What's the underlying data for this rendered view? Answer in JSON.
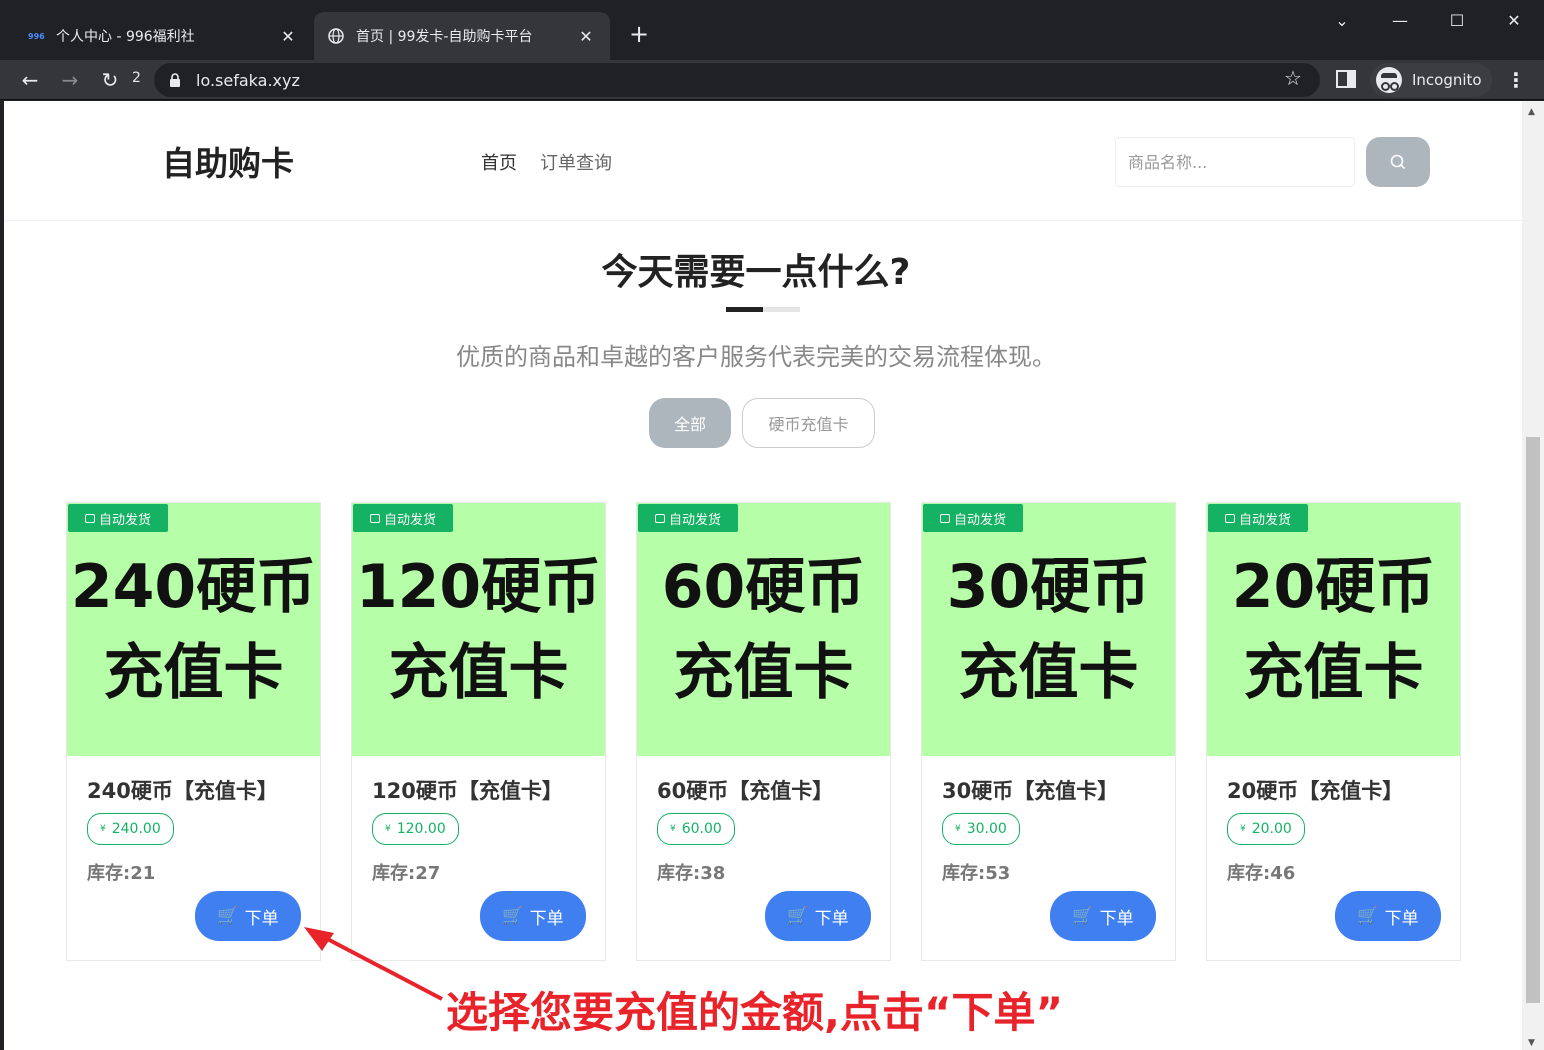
{
  "browser": {
    "tabs": [
      {
        "favicon": "996",
        "title": "个人中心 - 996福利社",
        "active": false
      },
      {
        "favicon": "globe-icon",
        "title": "首页 | 99发卡-自助购卡平台",
        "active": true
      }
    ],
    "reload_count": "2",
    "url": "lo.sefaka.xyz",
    "profile_label": "Incognito"
  },
  "site": {
    "brand": "自助购卡",
    "nav": [
      "首页",
      "订单查询"
    ],
    "search_placeholder": "商品名称..."
  },
  "hero": {
    "title": "今天需要一点什么?",
    "subtitle": "优质的商品和卓越的客户服务代表完美的交易流程体现。"
  },
  "filters": [
    "全部",
    "硬币充值卡"
  ],
  "badge_text": "自动发货",
  "order_label": "下单",
  "stock_prefix": "库存:",
  "products": [
    {
      "img_line1": "240硬币",
      "img_line2": "充值卡",
      "title": "240硬币【充值卡】",
      "price": "240.00",
      "stock": "21"
    },
    {
      "img_line1": "120硬币",
      "img_line2": "充值卡",
      "title": "120硬币【充值卡】",
      "price": "120.00",
      "stock": "27"
    },
    {
      "img_line1": "60硬币",
      "img_line2": "充值卡",
      "title": "60硬币【充值卡】",
      "price": "60.00",
      "stock": "38"
    },
    {
      "img_line1": "30硬币",
      "img_line2": "充值卡",
      "title": "30硬币【充值卡】",
      "price": "30.00",
      "stock": "53"
    },
    {
      "img_line1": "20硬币",
      "img_line2": "充值卡",
      "title": "20硬币【充值卡】",
      "price": "20.00",
      "stock": "46"
    }
  ],
  "annotation": "选择您要充值的金额,点击“下单”",
  "colors": {
    "accent": "#3f7ff0",
    "badge": "#14b262",
    "card_image": "#b7fea8",
    "annotation": "#e8232a"
  }
}
